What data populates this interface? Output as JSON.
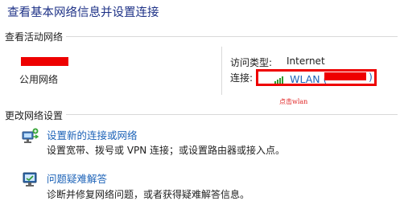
{
  "page": {
    "title": "查看基本网络信息并设置连接"
  },
  "active_networks": {
    "section_label": "查看活动网络",
    "network_type_label": "公用网络",
    "access_type_label": "访问类型:",
    "access_type_value": "Internet",
    "connection_label": "连接:",
    "connection_link": "WLAN (",
    "connection_link_close": ")",
    "annotation": "点击wlan"
  },
  "change_settings": {
    "section_label": "更改网络设置",
    "items": [
      {
        "title": "设置新的连接或网络",
        "desc": "设置宽带、拨号或 VPN 连接；或设置路由器或接入点。",
        "icon": "network-setup-icon"
      },
      {
        "title": "问题疑难解答",
        "desc": "诊断并修复网络问题，或者获得疑难解答信息。",
        "icon": "troubleshoot-icon"
      }
    ]
  },
  "colors": {
    "title": "#1e3287",
    "link": "#1d63b8",
    "redaction": "#ee0000"
  }
}
